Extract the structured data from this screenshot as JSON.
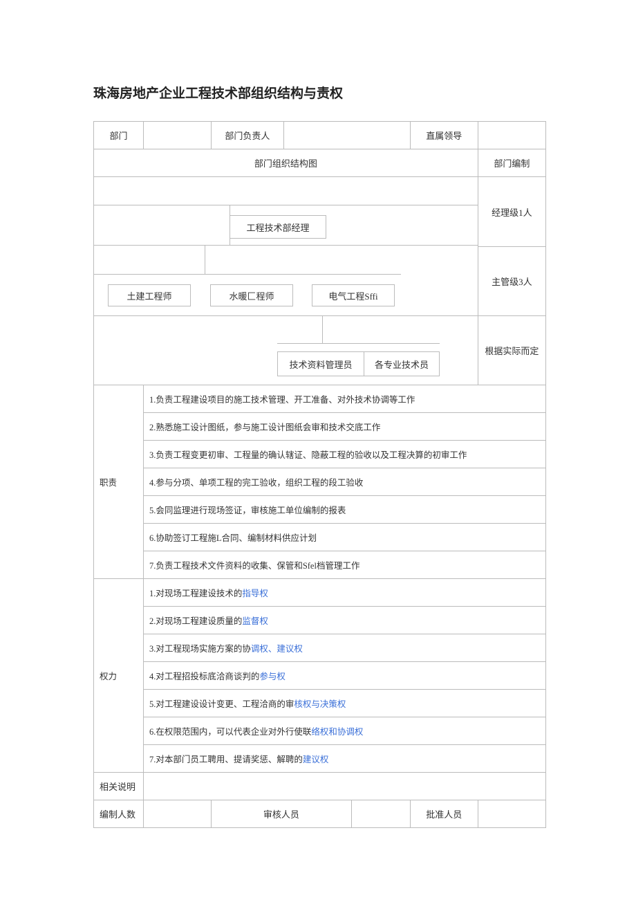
{
  "title": "珠海房地产企业工程技术部组织结构与责权",
  "header": {
    "col1": "部门",
    "col3": "部门负责人",
    "col5": "直属领导"
  },
  "row2": {
    "left": "部门组织结构图",
    "right": "部门编制"
  },
  "org": {
    "manager": "工程技术部经理",
    "eng1": "土建工程师",
    "eng2": "水暖匚程师",
    "eng3": "电气工程Sffi",
    "sub1": "技术资料管理员",
    "sub2": "各专业技术员"
  },
  "right_col": {
    "r1": "经理级1人",
    "r2": "主管级3人",
    "r3": "根据实际而定"
  },
  "duty_label": "职责",
  "duties": [
    "1.负责工程建设项目的施工技术管理、开工准备、对外技术协调等工作",
    "2.熟悉施工设计图纸，参与施工设计图纸会审和技术交底工作",
    "3.负责工程变更初审、工程量的确认辖证、隐蔽工程的验收以及工程决算的初审工作",
    "4.参与分项、单项工程的完工验收，组织工程的段工验收",
    "5.会同监理进行现场签证，审核施工单位编制的报表",
    "6.协助签订工程施L合同、编制材料供应计划",
    "7.负责工程技术文件资料的收集、保管和Sfel档管理工作"
  ],
  "power_label": "权力",
  "powers": [
    {
      "pre": "1.对现场工程建设技术的",
      "link": "指导权",
      "post": ""
    },
    {
      "pre": "2.对现场工程建设质量的",
      "link": "监督权",
      "post": ""
    },
    {
      "pre": "3.对工程现场实施方案的协",
      "link": "调权、建议权",
      "post": ""
    },
    {
      "pre": "4.对工程招投标底洽商谈判的",
      "link": "参与权",
      "post": ""
    },
    {
      "pre": "5.对工程建设设计变更、工程洽商的审",
      "link": "核权与决策权",
      "post": ""
    },
    {
      "pre": "6.在权限范围内，可以代表企业对外行使联",
      "link": "络权和协调权",
      "post": ""
    },
    {
      "pre": "7.对本部门员工聘用、提请奖惩、解聘的",
      "link": "建议权",
      "post": ""
    }
  ],
  "notes_label": "相关说明",
  "footer": {
    "c1": "编制人数",
    "c3": "审核人员",
    "c5": "批准人员"
  }
}
